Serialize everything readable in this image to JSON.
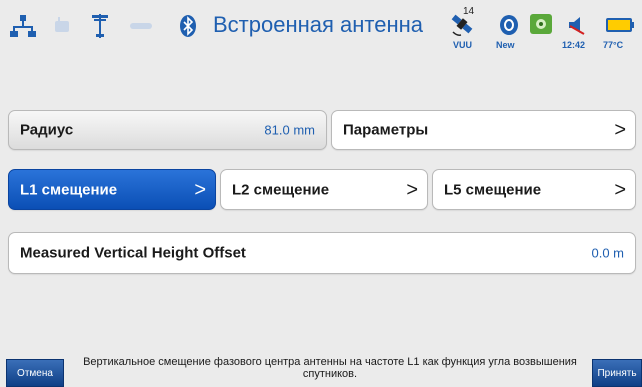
{
  "status": {
    "title": "Встроенная антенна",
    "satellite_count": "14",
    "satellite_caption": "VUU",
    "new_caption": "New",
    "time": "12:42",
    "temperature": "77°C",
    "icons": [
      "network-icon",
      "radio-icon",
      "antenna-icon",
      "link-icon",
      "bluetooth-icon",
      "satellite-icon",
      "new-badge-icon",
      "gnss-status-icon",
      "speaker-icon",
      "battery-icon"
    ]
  },
  "fields": {
    "radius_label": "Радиус",
    "radius_value": "81.0 mm",
    "params_label": "Параметры",
    "l1_label": "L1 смещение",
    "l2_label": "L2 смещение",
    "l5_label": "L5 смещение",
    "mvho_label": "Measured Vertical Height Offset",
    "mvho_value": "0.0 m",
    "chevron": ">"
  },
  "footer": {
    "cancel_label": "Отмена",
    "accept_label": "Принять",
    "hint": "Вертикальное смещение фазового центра антенны на частоте L1 как функция угла возвышения спутников."
  },
  "colors": {
    "accent": "#1f5fb0",
    "active_tab": "#0b4fb5",
    "background": "#ebebeb"
  }
}
